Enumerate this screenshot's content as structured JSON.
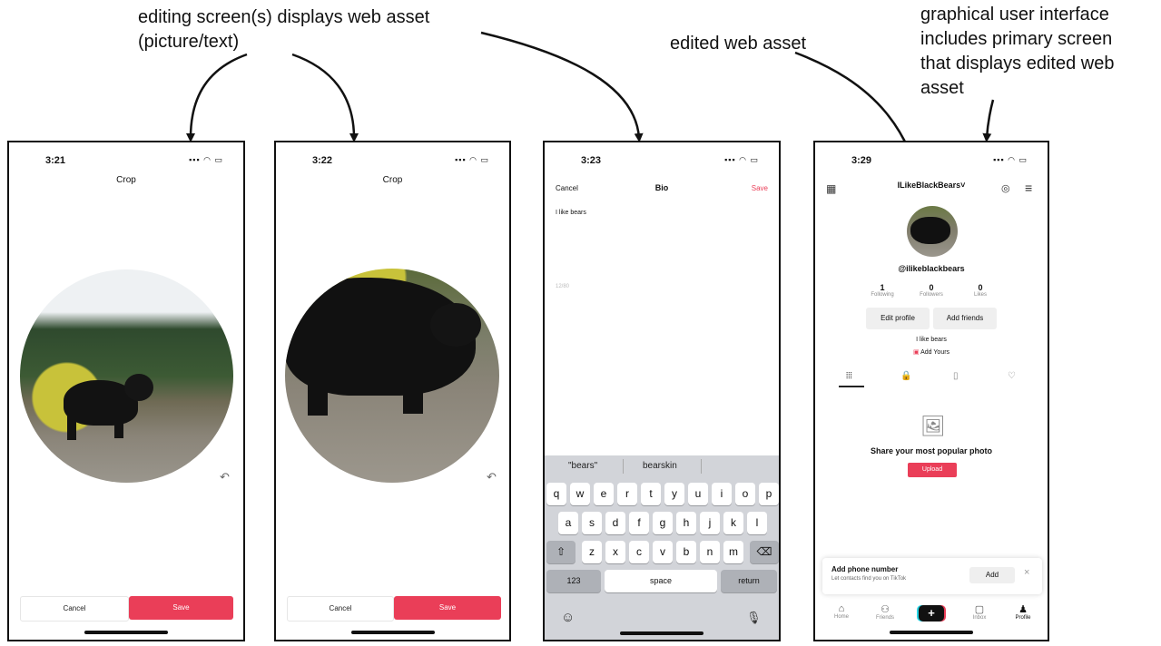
{
  "annotations": {
    "editing_screens": [
      "editing screen(s) displays web asset",
      "(picture/text)"
    ],
    "edited_asset": "edited web asset",
    "gui_primary": [
      "graphical user interface",
      "includes primary screen",
      "that displays edited web",
      "asset"
    ]
  },
  "screen1": {
    "time": "3:21",
    "title": "Crop",
    "cancel": "Cancel",
    "save": "Save",
    "undo": "↶"
  },
  "screen2": {
    "time": "3:22",
    "title": "Crop",
    "cancel": "Cancel",
    "save": "Save",
    "undo": "↶"
  },
  "screen3": {
    "time": "3:23",
    "cancel": "Cancel",
    "title": "Bio",
    "save": "Save",
    "bio_text": "I like bears",
    "counter": "12/80",
    "suggestions": [
      "\"bears\"",
      "bearskin"
    ],
    "row1": [
      "q",
      "w",
      "e",
      "r",
      "t",
      "y",
      "u",
      "i",
      "o",
      "p"
    ],
    "row2": [
      "a",
      "s",
      "d",
      "f",
      "g",
      "h",
      "j",
      "k",
      "l"
    ],
    "row3": [
      "z",
      "x",
      "c",
      "v",
      "b",
      "n",
      "m"
    ],
    "shift": "⇧",
    "backspace": "⌫",
    "numbers": "123",
    "space": "space",
    "return": "return",
    "emoji": "☺",
    "mic": "🎙"
  },
  "screen4": {
    "time": "3:29",
    "username": "ILikeBlackBears˅",
    "handle": "@ilikeblackbears",
    "stats": [
      {
        "value": "1",
        "label": "Following"
      },
      {
        "value": "0",
        "label": "Followers"
      },
      {
        "value": "0",
        "label": "Likes"
      }
    ],
    "edit_profile": "Edit profile",
    "add_friends": "Add friends",
    "bio": "I like bears",
    "add_yours": "Add Yours",
    "empty_title": "Share your most popular photo",
    "upload": "Upload",
    "phone_title": "Add phone number",
    "phone_sub": "Let contacts find you on TikTok",
    "phone_add": "Add",
    "phone_close": "×",
    "nav": [
      "Home",
      "Friends",
      "",
      "Inbox",
      "Profile"
    ]
  },
  "status_text": "▪▪▪ ◠ ▭",
  "colors": {
    "accent": "#ea3e58",
    "keyboard": "#d2d4d9"
  }
}
